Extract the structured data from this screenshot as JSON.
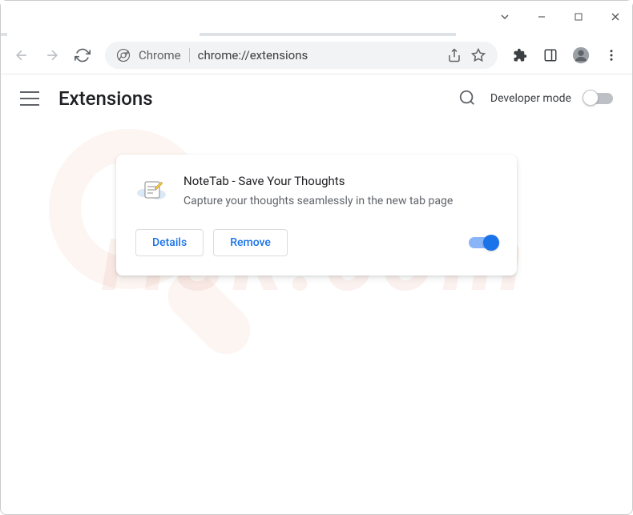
{
  "window": {
    "tab_title": "Extensions",
    "address_label": "Chrome",
    "address_url": "chrome://extensions"
  },
  "header": {
    "title": "Extensions",
    "dev_mode_label": "Developer mode"
  },
  "extension": {
    "name": "NoteTab - Save Your Thoughts",
    "description": "Capture your thoughts seamlessly in the new tab page",
    "details_label": "Details",
    "remove_label": "Remove",
    "enabled": true
  }
}
